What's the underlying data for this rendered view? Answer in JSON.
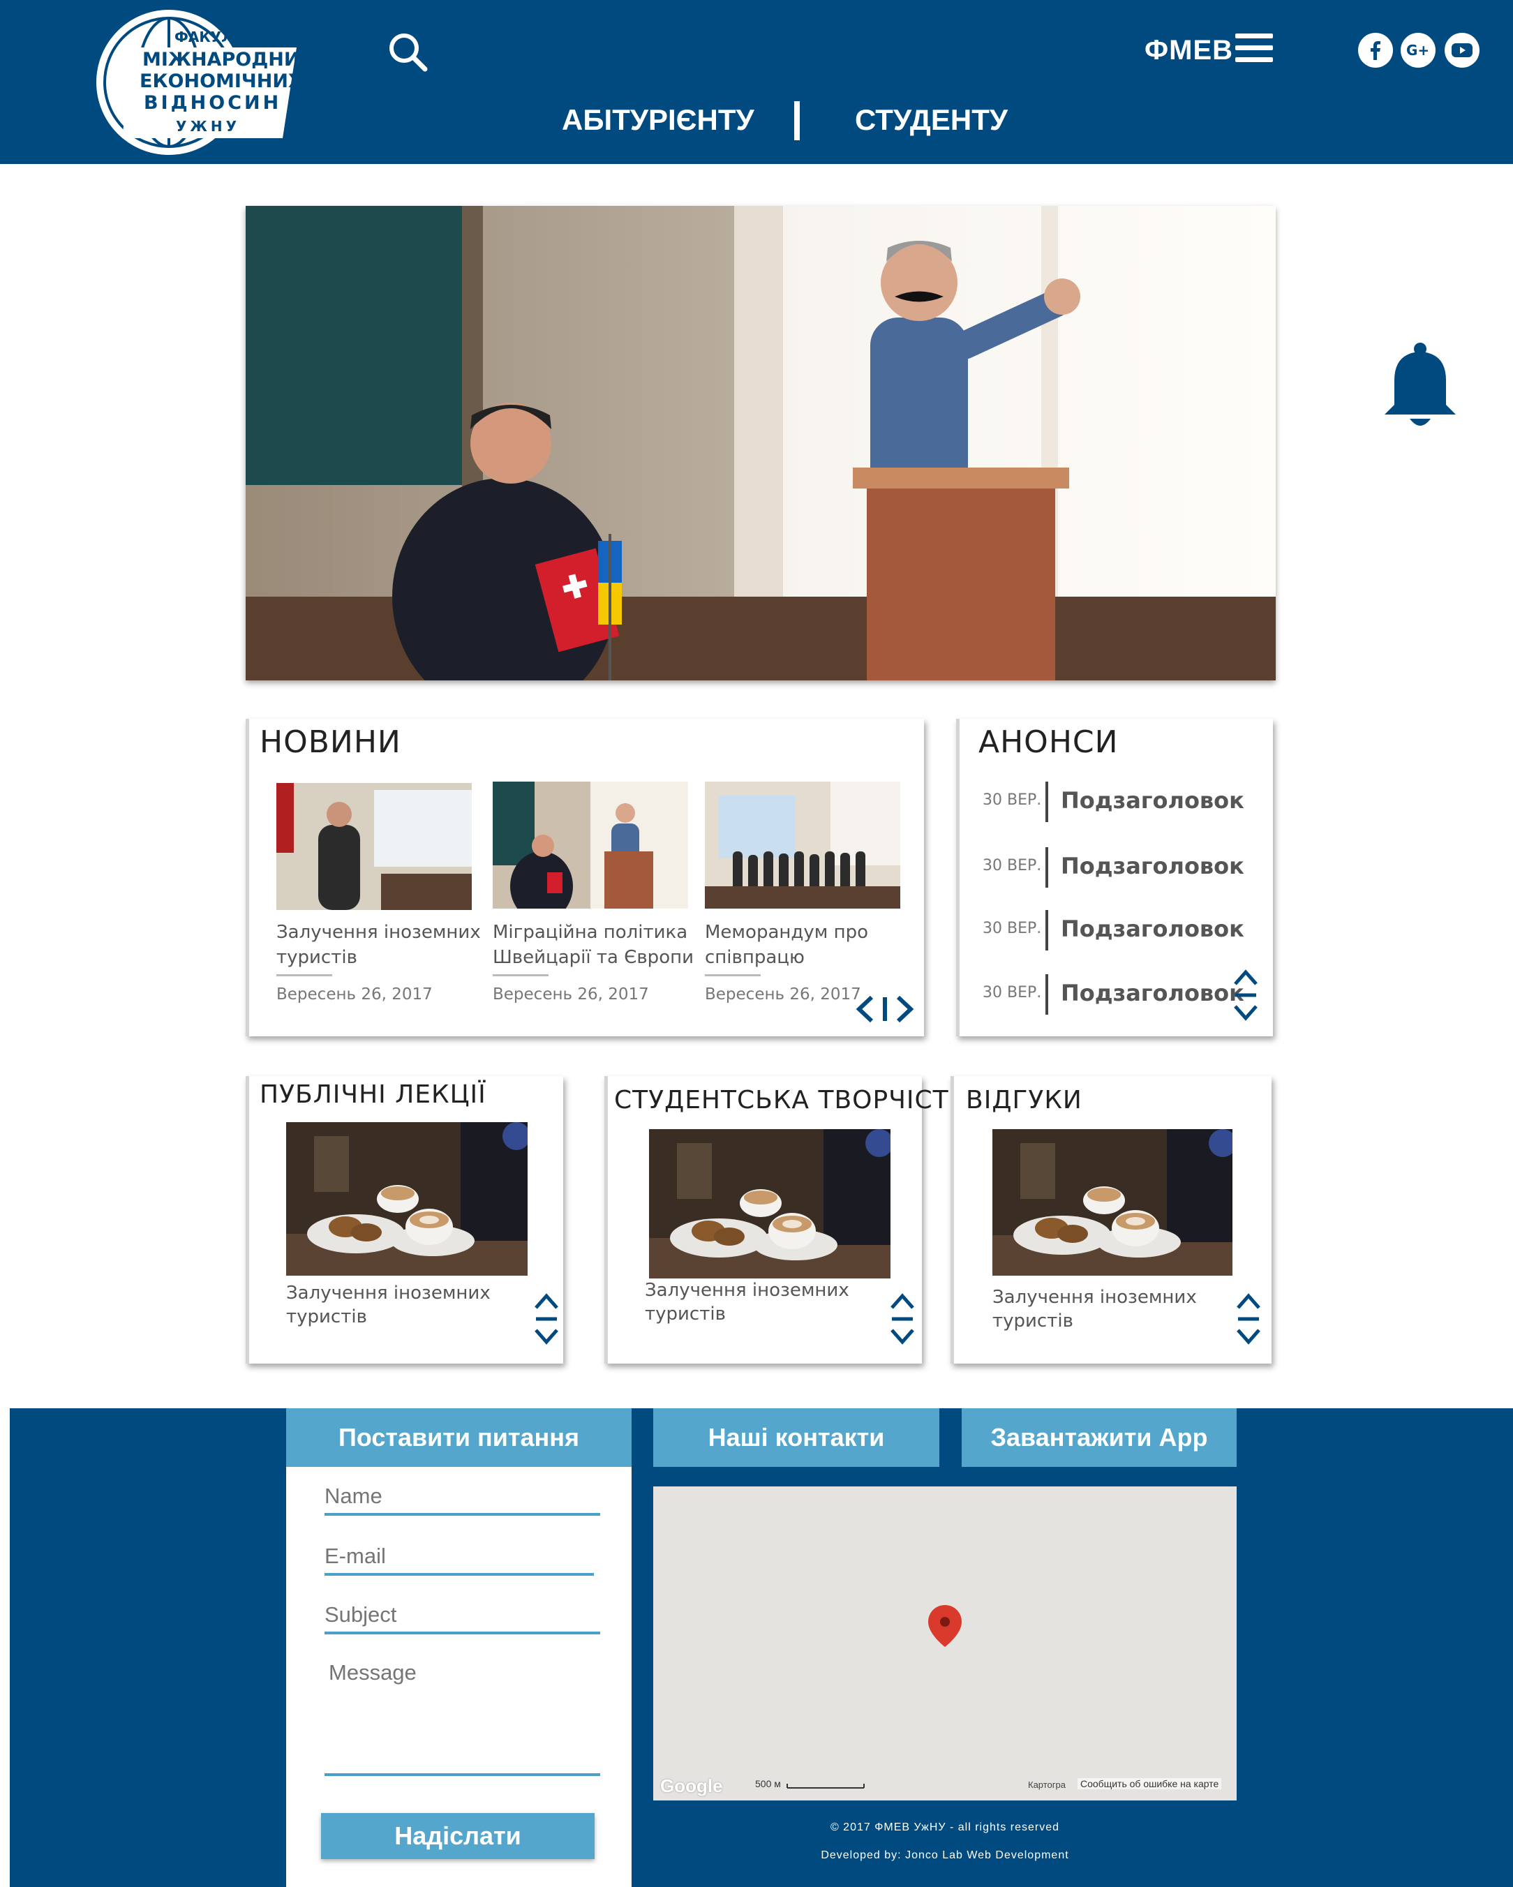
{
  "header": {
    "logo": {
      "line1": "ФАКУЛЬТЕТ",
      "line2": "МІЖНАРОДНИХ",
      "line3": "ЕКОНОМІЧНИХ",
      "line4": "ВІДНОСИН",
      "line5": "УЖНУ"
    },
    "site_name": "ФМЕВ",
    "nav": [
      "АБІТУРІЄНТУ",
      "СТУДЕНТУ"
    ],
    "social": [
      "facebook-icon",
      "google-plus-icon",
      "youtube-icon"
    ],
    "colors": {
      "header_bg": "#004a80",
      "accent": "#54a6cc"
    }
  },
  "news": {
    "title": "НОВИНИ",
    "items": [
      {
        "caption": "Залучення іноземних туристів",
        "date": "Вересень 26, 2017"
      },
      {
        "caption": "Міграційна політика Швейцарії та Європи",
        "date": "Вересень 26, 2017"
      },
      {
        "caption": "Меморандум про співпрацю",
        "date": "Вересень 26, 2017"
      }
    ]
  },
  "announcements": {
    "title": "АНОНСИ",
    "items": [
      {
        "date": "30 ВЕР.",
        "text": "Подзаголовок"
      },
      {
        "date": "30 ВЕР.",
        "text": "Подзаголовок"
      },
      {
        "date": "30 ВЕР.",
        "text": "Подзаголовок"
      },
      {
        "date": "30 ВЕР.",
        "text": "Подзаголовок"
      }
    ]
  },
  "cards": [
    {
      "title": "ПУБЛІЧНІ ЛЕКЦІЇ",
      "caption": "Залучення іноземних туристів"
    },
    {
      "title": "СТУДЕНТСЬКА ТВОРЧІСТЬ",
      "caption": "Залучення іноземних туристів"
    },
    {
      "title": "ВІДГУКИ",
      "caption": "Залучення іноземних туристів"
    }
  ],
  "footer": {
    "tabs": [
      "Поставити питання",
      "Наші контакти",
      "Завантажити App"
    ],
    "form": {
      "name_placeholder": "Name",
      "email_placeholder": "E-mail",
      "subject_placeholder": "Subject",
      "message_placeholder": "Message",
      "submit_label": "Надіслати"
    },
    "map": {
      "brand": "Google",
      "scale": "500 м",
      "attribution": "Картогра",
      "report": "Сообщить об ошибке на карте"
    },
    "copyright": "© 2017 ФМЕВ УжНУ - all rights reserved",
    "developer": "Developed by: Jonco Lab Web Development"
  }
}
